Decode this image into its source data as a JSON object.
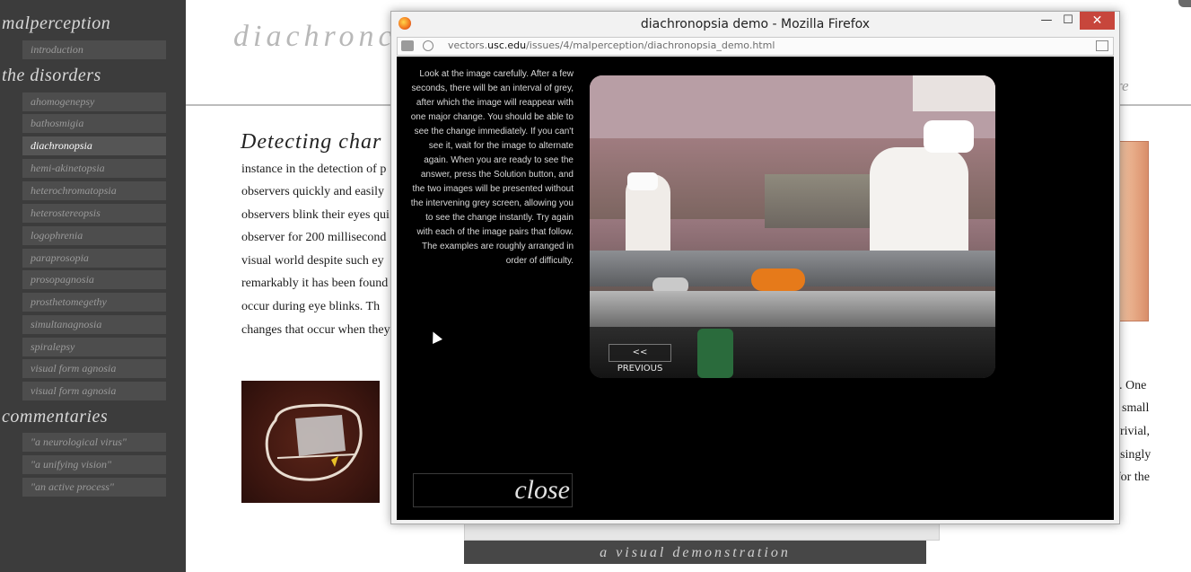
{
  "sidebar": {
    "section_malperception": "malperception",
    "section_disorders": "the disorders",
    "section_commentaries": "commentaries",
    "intro_item": "introduction",
    "disorders": [
      "ahomogenepsy",
      "bathosmigia",
      "diachronopsia",
      "hemi-akinetopsia",
      "heterochromatopsia",
      "heterostereopsis",
      "logophrenia",
      "paraprosopia",
      "prosopagnosia",
      "prosthetomegethy",
      "simultanagnosia",
      "spiralepsy",
      "visual form agnosia",
      "visual form agnosia"
    ],
    "active_disorder": "diachronopsia",
    "commentaries": [
      "\"a neurological virus\"",
      "\"a unifying vision\"",
      "\"an active process\""
    ]
  },
  "article": {
    "header_title": "diachronc",
    "header_right_fragment": "re",
    "heading": "Detecting char",
    "lines": [
      "instance in the detection of p",
      "observers quickly and easily",
      "observers blink their eyes qui",
      "observer for 200 millisecond",
      "visual world despite such ey",
      "remarkably it has been found",
      "occur during eye blinks. Th",
      "changes that occur when they"
    ],
    "right_lines": [
      "3. One",
      "small",
      "rivial,",
      "singly",
      "for the"
    ],
    "banner": "a visual demonstration"
  },
  "popup": {
    "window_title": "diachronopsia demo - Mozilla Firefox",
    "url_prefix": "vectors.",
    "url_domain": "usc.edu",
    "url_path": "/issues/4/malperception/diachronopsia_demo.html",
    "instructions": "Look at the image carefully. After a few seconds, there will be an interval of grey, after which the image will reappear with one major change. You should be able to see the change immediately. If you can't see it, wait for the image to alternate again. When you are ready to see the answer, press the Solution button, and the two images will be presented without the intervening grey screen, allowing you to see the change instantly. Try again with each of the image pairs that follow. The examples are roughly arranged in order of difficulty.",
    "prev_label": "<< PREVIOUS",
    "close_label": "close",
    "btn_minimize": "—",
    "btn_maximize": "☐",
    "btn_close": "✕"
  }
}
